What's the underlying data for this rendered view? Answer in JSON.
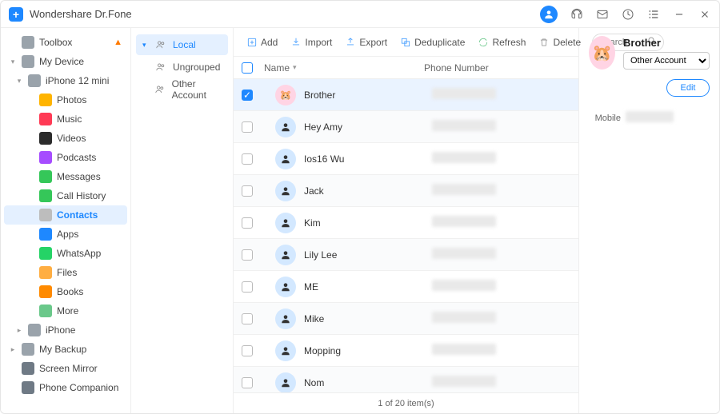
{
  "app": {
    "title": "Wondershare Dr.Fone"
  },
  "sidebar": [
    {
      "label": "Toolbox",
      "level": 0,
      "icon": "home",
      "iconColor": "#9aa3ab",
      "flame": true
    },
    {
      "label": "My Device",
      "level": 0,
      "icon": "tablet",
      "iconColor": "#9aa3ab",
      "caret": "down"
    },
    {
      "label": "iPhone 12 mini",
      "level": 1,
      "icon": "phone",
      "iconColor": "#9aa3ab",
      "caret": "down"
    },
    {
      "label": "Photos",
      "level": 2,
      "icon": "photos",
      "iconColor": "#ffb400"
    },
    {
      "label": "Music",
      "level": 2,
      "icon": "music",
      "iconColor": "#ff3a55"
    },
    {
      "label": "Videos",
      "level": 2,
      "icon": "videos",
      "iconColor": "#2b2b2b"
    },
    {
      "label": "Podcasts",
      "level": 2,
      "icon": "podcasts",
      "iconColor": "#a64cff"
    },
    {
      "label": "Messages",
      "level": 2,
      "icon": "messages",
      "iconColor": "#35c759"
    },
    {
      "label": "Call History",
      "level": 2,
      "icon": "calls",
      "iconColor": "#35c759"
    },
    {
      "label": "Contacts",
      "level": 2,
      "icon": "contacts",
      "iconColor": "#bdbdbd",
      "active": true
    },
    {
      "label": "Apps",
      "level": 2,
      "icon": "apps",
      "iconColor": "#1e88ff"
    },
    {
      "label": "WhatsApp",
      "level": 2,
      "icon": "whatsapp",
      "iconColor": "#25d366"
    },
    {
      "label": "Files",
      "level": 2,
      "icon": "files",
      "iconColor": "#ffae42"
    },
    {
      "label": "Books",
      "level": 2,
      "icon": "books",
      "iconColor": "#ff8a00"
    },
    {
      "label": "More",
      "level": 2,
      "icon": "more",
      "iconColor": "#6ac88a"
    },
    {
      "label": "iPhone",
      "level": 1,
      "icon": "phone",
      "iconColor": "#9aa3ab",
      "caret": "right"
    },
    {
      "label": "My Backup",
      "level": 0,
      "icon": "backup",
      "iconColor": "#9aa3ab",
      "caret": "right"
    },
    {
      "label": "Screen Mirror",
      "level": 0,
      "icon": "mirror",
      "iconColor": "#6f7a85"
    },
    {
      "label": "Phone Companion",
      "level": 0,
      "icon": "companion",
      "iconColor": "#6f7a85"
    }
  ],
  "subsidebar": [
    {
      "label": "Local",
      "active": true,
      "caret": "down"
    },
    {
      "label": "Ungrouped"
    },
    {
      "label": "Other Account"
    }
  ],
  "toolbar": {
    "add": "Add",
    "import": "Import",
    "export": "Export",
    "deduplicate": "Deduplicate",
    "refresh": "Refresh",
    "delete": "Delete",
    "search_placeholder": "Search"
  },
  "table": {
    "head_name": "Name",
    "head_phone": "Phone Number",
    "rows": [
      {
        "name": "Brother",
        "selected": true,
        "pink": true
      },
      {
        "name": "Hey  Amy"
      },
      {
        "name": "Ios16  Wu"
      },
      {
        "name": "Jack"
      },
      {
        "name": "Kim"
      },
      {
        "name": "Lily  Lee"
      },
      {
        "name": "ME"
      },
      {
        "name": "Mike"
      },
      {
        "name": "Mopping"
      },
      {
        "name": "Nom"
      }
    ],
    "footer": "1  of  20  item(s)"
  },
  "detail": {
    "name": "Brother",
    "account_options": [
      "Other Account"
    ],
    "account_selected": "Other Account",
    "edit": "Edit",
    "mobile_label": "Mobile"
  }
}
